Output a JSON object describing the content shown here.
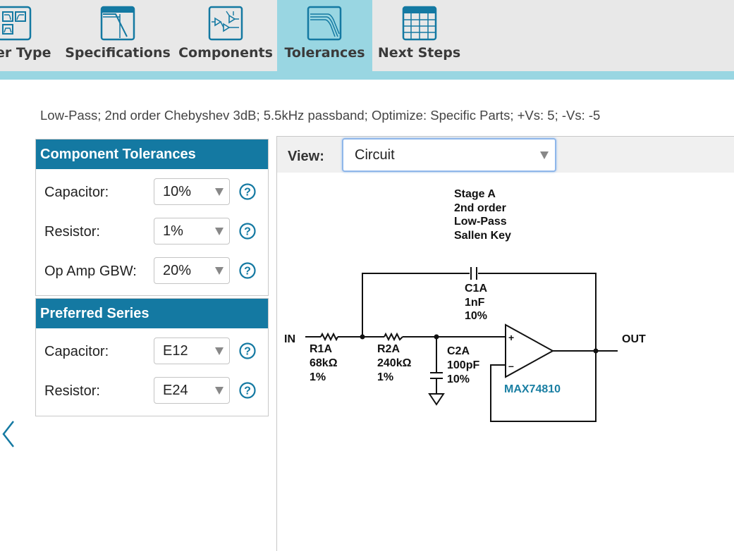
{
  "tabs": [
    {
      "label": "er Type",
      "icon": "filter-type-icon"
    },
    {
      "label": "Specifications",
      "icon": "specifications-icon"
    },
    {
      "label": "Components",
      "icon": "components-icon"
    },
    {
      "label": "Tolerances",
      "icon": "tolerances-icon",
      "active": true
    },
    {
      "label": "Next Steps",
      "icon": "next-steps-icon"
    }
  ],
  "summary": "Low-Pass; 2nd order Chebyshev 3dB; 5.5kHz passband; Optimize: Specific Parts; +Vs: 5; -Vs: -5",
  "component_tolerances": {
    "title": "Component Tolerances",
    "rows": [
      {
        "label": "Capacitor:",
        "value": "10%"
      },
      {
        "label": "Resistor:",
        "value": "1%"
      },
      {
        "label": "Op Amp GBW:",
        "value": "20%"
      }
    ]
  },
  "preferred_series": {
    "title": "Preferred Series",
    "rows": [
      {
        "label": "Capacitor:",
        "value": "E12"
      },
      {
        "label": "Resistor:",
        "value": "E24"
      }
    ]
  },
  "view": {
    "label": "View:",
    "selected": "Circuit"
  },
  "circuit": {
    "stage_lines": [
      "Stage A",
      "2nd order",
      "Low-Pass",
      "Sallen Key"
    ],
    "in_label": "IN",
    "out_label": "OUT",
    "r1": {
      "name": "R1A",
      "value": "68kΩ",
      "tol": "1%"
    },
    "r2": {
      "name": "R2A",
      "value": "240kΩ",
      "tol": "1%"
    },
    "c1": {
      "name": "C1A",
      "value": "1nF",
      "tol": "10%"
    },
    "c2": {
      "name": "C2A",
      "value": "100pF",
      "tol": "10%"
    },
    "plus": "+",
    "minus": "–",
    "opamp": "MAX74810",
    "opamp_color": "#1a7fa3"
  },
  "colors": {
    "accent": "#1479a2",
    "tab_active": "#99d6e2"
  }
}
